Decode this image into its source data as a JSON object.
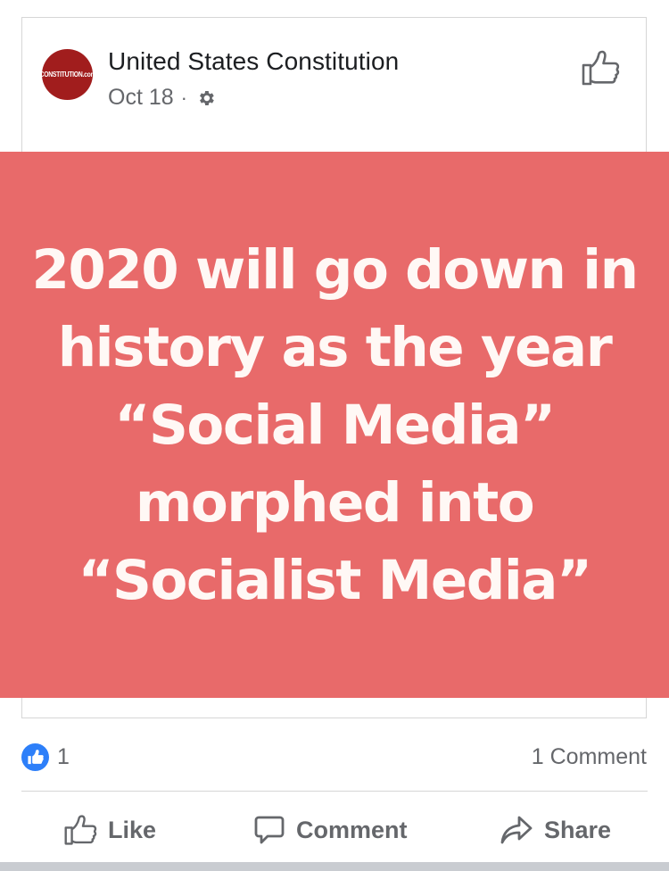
{
  "post": {
    "page_name": "United States Constitution",
    "avatar_text": "CONSTITUTION.com",
    "date": "Oct 18",
    "separator": "·",
    "image_text_lines": [
      "2020 will go down in",
      "history as the year",
      "“Social Media”",
      "morphed into",
      "“Socialist Media”"
    ],
    "image_background": "#e86a6a"
  },
  "stats": {
    "reaction_count": "1",
    "comments": "1 Comment"
  },
  "actions": {
    "like_label": "Like",
    "comment_label": "Comment",
    "share_label": "Share"
  },
  "icons": [
    "gear-icon",
    "thumbs-up-icon",
    "like-reaction-icon",
    "comment-icon",
    "share-icon"
  ],
  "colors": {
    "accent": "#2d7ff9",
    "text_secondary": "#65676b",
    "avatar": "#a11d1d"
  }
}
